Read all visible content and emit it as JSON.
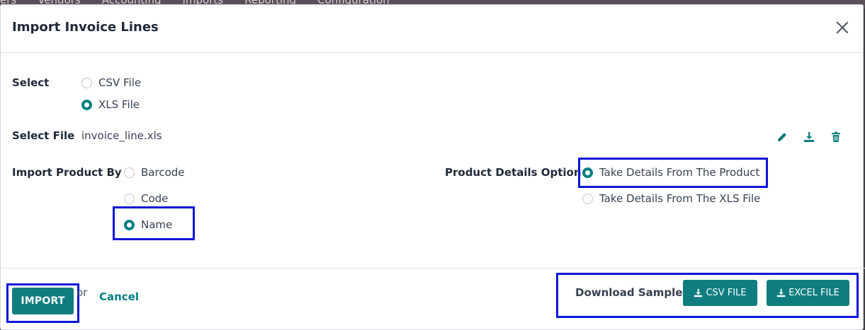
{
  "navbar": {
    "items": [
      "ers",
      "Vendors",
      "Accounting",
      "Imports",
      "Reporting",
      "Configuration"
    ]
  },
  "modal": {
    "title": "Import Invoice Lines"
  },
  "select": {
    "label": "Select",
    "options": [
      {
        "label": "CSV File",
        "checked": false
      },
      {
        "label": "XLS File",
        "checked": true
      }
    ]
  },
  "select_file": {
    "label": "Select File",
    "filename": "invoice_line.xls"
  },
  "import_product_by": {
    "label": "Import Product By",
    "options": [
      {
        "label": "Barcode",
        "checked": false
      },
      {
        "label": "Code",
        "checked": false
      },
      {
        "label": "Name",
        "checked": true
      }
    ]
  },
  "product_details": {
    "label": "Product Details Option",
    "options": [
      {
        "label": "Take Details From The Product",
        "checked": true
      },
      {
        "label": "Take Details From The XLS File",
        "checked": false
      }
    ]
  },
  "footer": {
    "import_label": "IMPORT",
    "or_label": "or",
    "cancel_label": "Cancel",
    "download_label": "Download Sample:",
    "csv_label": "CSV FILE",
    "excel_label": "EXCEL FILE"
  },
  "colors": {
    "primary": "#017e84",
    "highlight": "#0b15d8"
  }
}
